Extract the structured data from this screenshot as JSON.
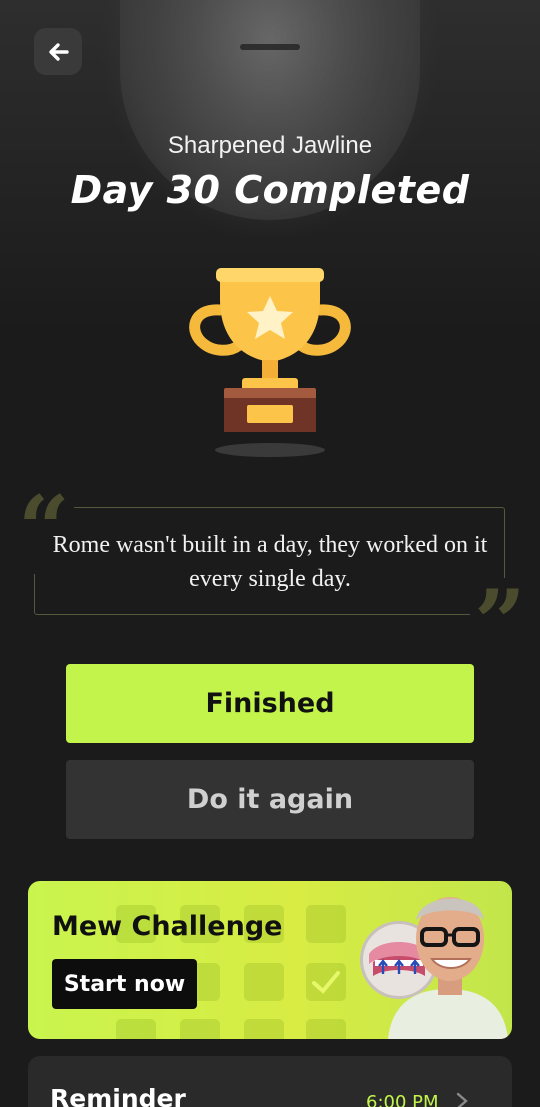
{
  "header": {
    "back_icon": "arrow-left-icon",
    "subtitle": "Sharpened Jawline",
    "title": "Day 30 Completed"
  },
  "trophy": {
    "icon": "trophy-icon"
  },
  "quote": {
    "text": "Rome wasn't built in a day, they worked on it every single day.",
    "open_mark": "“",
    "close_mark": "”"
  },
  "actions": {
    "finished_label": "Finished",
    "again_label": "Do it again"
  },
  "challenge": {
    "title": "Mew Challenge",
    "start_label": "Start now"
  },
  "reminder": {
    "label": "Reminder",
    "time": "6:00 PM",
    "chevron_icon": "chevron-right-icon"
  },
  "colors": {
    "accent": "#c2f44c",
    "background": "#1b1b1b",
    "secondary_button": "#333333"
  }
}
